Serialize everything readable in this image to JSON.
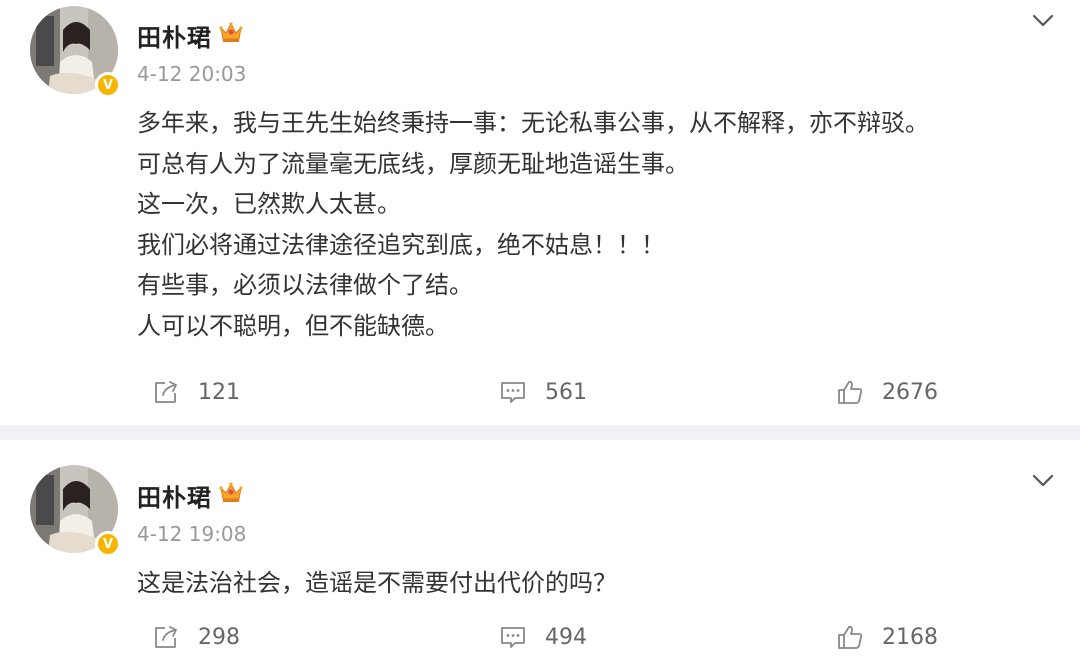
{
  "posts": [
    {
      "author": "田朴珺",
      "time": "4-12 20:03",
      "lines": [
        "多年来，我与王先生始终秉持一事：无论私事公事，从不解释，亦不辩驳。",
        "可总有人为了流量毫无底线，厚颜无耻地造谣生事。",
        "这一次，已然欺人太甚。",
        "我们必将通过法律途径追究到底，绝不姑息！！！",
        "有些事，必须以法律做个了结。",
        "人可以不聪明，但不能缺德。"
      ],
      "reposts": "121",
      "comments": "561",
      "likes": "2676"
    },
    {
      "author": "田朴珺",
      "time": "4-12 19:08",
      "lines": [
        "这是法治社会，造谣是不需要付出代价的吗？"
      ],
      "reposts": "298",
      "comments": "494",
      "likes": "2168"
    }
  ],
  "badge": {
    "verified_mark": "V"
  },
  "icons": {
    "avatar": "avatar-photo",
    "verified": "verified-badge-icon",
    "crown": "crown-icon",
    "menu": "chevron-down-icon",
    "repost": "repost-icon",
    "comment": "comment-icon",
    "like": "thumbs-up-icon"
  },
  "colors": {
    "background": "#f1f2f5",
    "card": "#ffffff",
    "verified": "#f7b500",
    "text_primary": "#333333",
    "text_secondary": "#999999"
  }
}
